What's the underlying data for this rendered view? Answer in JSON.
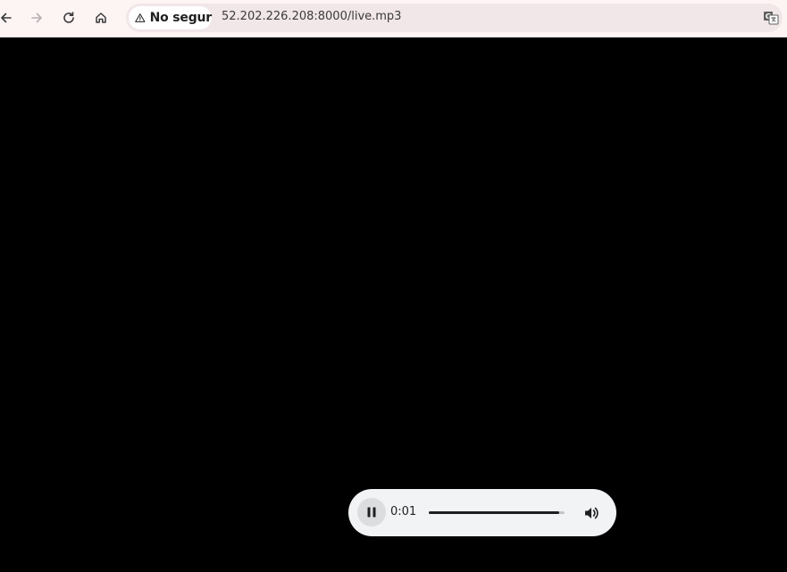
{
  "browser": {
    "security_label": "No segur",
    "url": "52.202.226.208:8000/live.mp3",
    "icons": [
      "back-icon",
      "forward-icon",
      "reload-icon",
      "home-icon",
      "warning-icon",
      "translate-icon"
    ]
  },
  "player": {
    "current_time": "0:01",
    "progress_fraction": 0.96,
    "state": "playing",
    "icons": [
      "pause-icon",
      "volume-icon"
    ]
  }
}
